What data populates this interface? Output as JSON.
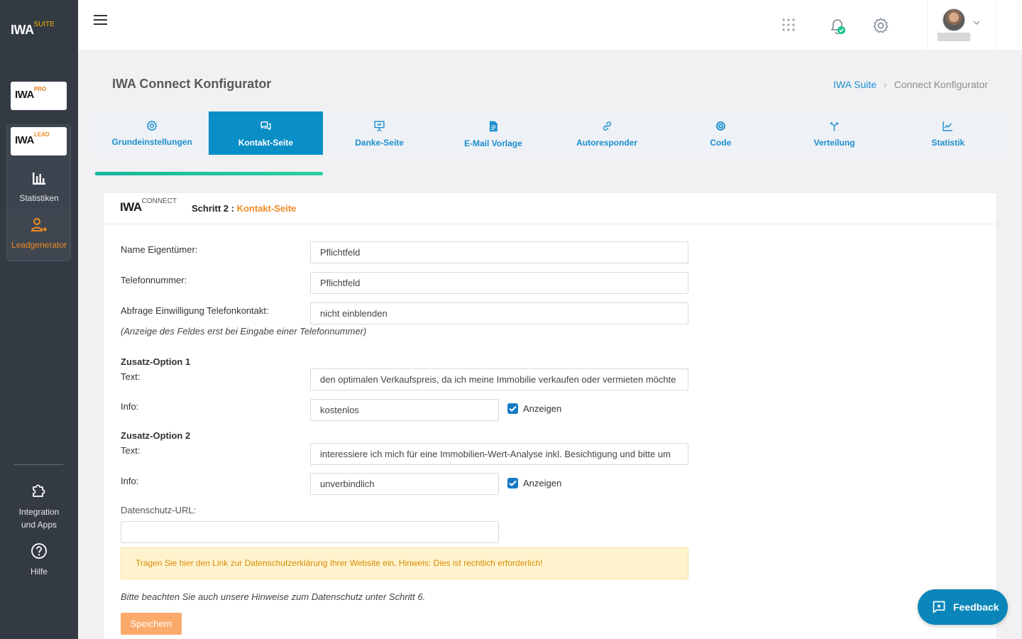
{
  "sidebar": {
    "logo_main": "IWA",
    "logo_main_sup": "SUITE",
    "brand_pro": "IWA",
    "brand_pro_sup": "PRO",
    "brand_lead": "IWA",
    "brand_lead_sup": "LEAD",
    "items": [
      {
        "label": "Statistiken"
      },
      {
        "label": "Leadgenerator"
      }
    ],
    "integration_line1": "Integration",
    "integration_line2": "und Apps",
    "help_label": "Hilfe"
  },
  "header": {
    "title": "IWA Connect Konfigurator",
    "breadcrumb": {
      "home": "IWA Suite",
      "current": "Connect Konfigurator"
    }
  },
  "tabs": [
    {
      "label": "Grundeinstellungen",
      "icon": "gear-icon"
    },
    {
      "label": "Kontakt-Seite",
      "icon": "chat-icon"
    },
    {
      "label": "Danke-Seite",
      "icon": "presentation-icon"
    },
    {
      "label": "E-Mail Vorlage",
      "icon": "document-icon"
    },
    {
      "label": "Autoresponder",
      "icon": "link-icon"
    },
    {
      "label": "Code",
      "icon": "target-icon"
    },
    {
      "label": "Verteilung",
      "icon": "split-arrow-icon"
    },
    {
      "label": "Statistik",
      "icon": "chart-icon"
    }
  ],
  "progress": {
    "fraction": 0.25
  },
  "card": {
    "logo": "IWA",
    "logo_sup": "CONNECT",
    "step_prefix": "Schritt 2 :",
    "step_name": "Kontakt-Seite"
  },
  "form": {
    "owner_label": "Name Eigentümer:",
    "owner_value": "Pflichtfeld",
    "phone_label": "Telefonnummer:",
    "phone_value": "Pflichtfeld",
    "consent_label": "Abfrage Einwilligung Telefonkontakt:",
    "consent_value": "nicht einblenden",
    "consent_note": "(Anzeige des Feldes erst bei Eingabe einer Telefonnummer)",
    "opt1_heading": "Zusatz-Option 1",
    "opt1_text_label": "Text:",
    "opt1_text_value": "den optimalen Verkaufspreis, da ich meine Immobilie verkaufen oder vermieten möchte",
    "opt1_info_label": "Info:",
    "opt1_info_value": "kostenlos",
    "opt1_show_label": "Anzeigen",
    "opt2_heading": "Zusatz-Option 2",
    "opt2_text_label": "Text:",
    "opt2_text_value": "interessiere ich mich für eine Immobilien-Wert-Analyse inkl. Besichtigung und bitte um",
    "opt2_info_label": "Info:",
    "opt2_info_value": "unverbindlich",
    "opt2_show_label": "Anzeigen",
    "privacy_label": "Datenschutz-URL:",
    "privacy_value": "",
    "alert_text": "Tragen Sie hier den Link zur Datenschutzerklärung Ihrer Website ein. Hinweis: Dies ist rechtlich erforderlich!",
    "footer_note": "Bitte beachten Sie auch unsere Hinweise zum Datenschutz unter Schritt 6.",
    "save_label": "Speichern"
  },
  "feedback_label": "Feedback",
  "colors": {
    "sidebar": "#333a44",
    "accent_blue": "#0a8ec6",
    "accent_orange": "#f08a24",
    "progress": "#1cc39e"
  }
}
